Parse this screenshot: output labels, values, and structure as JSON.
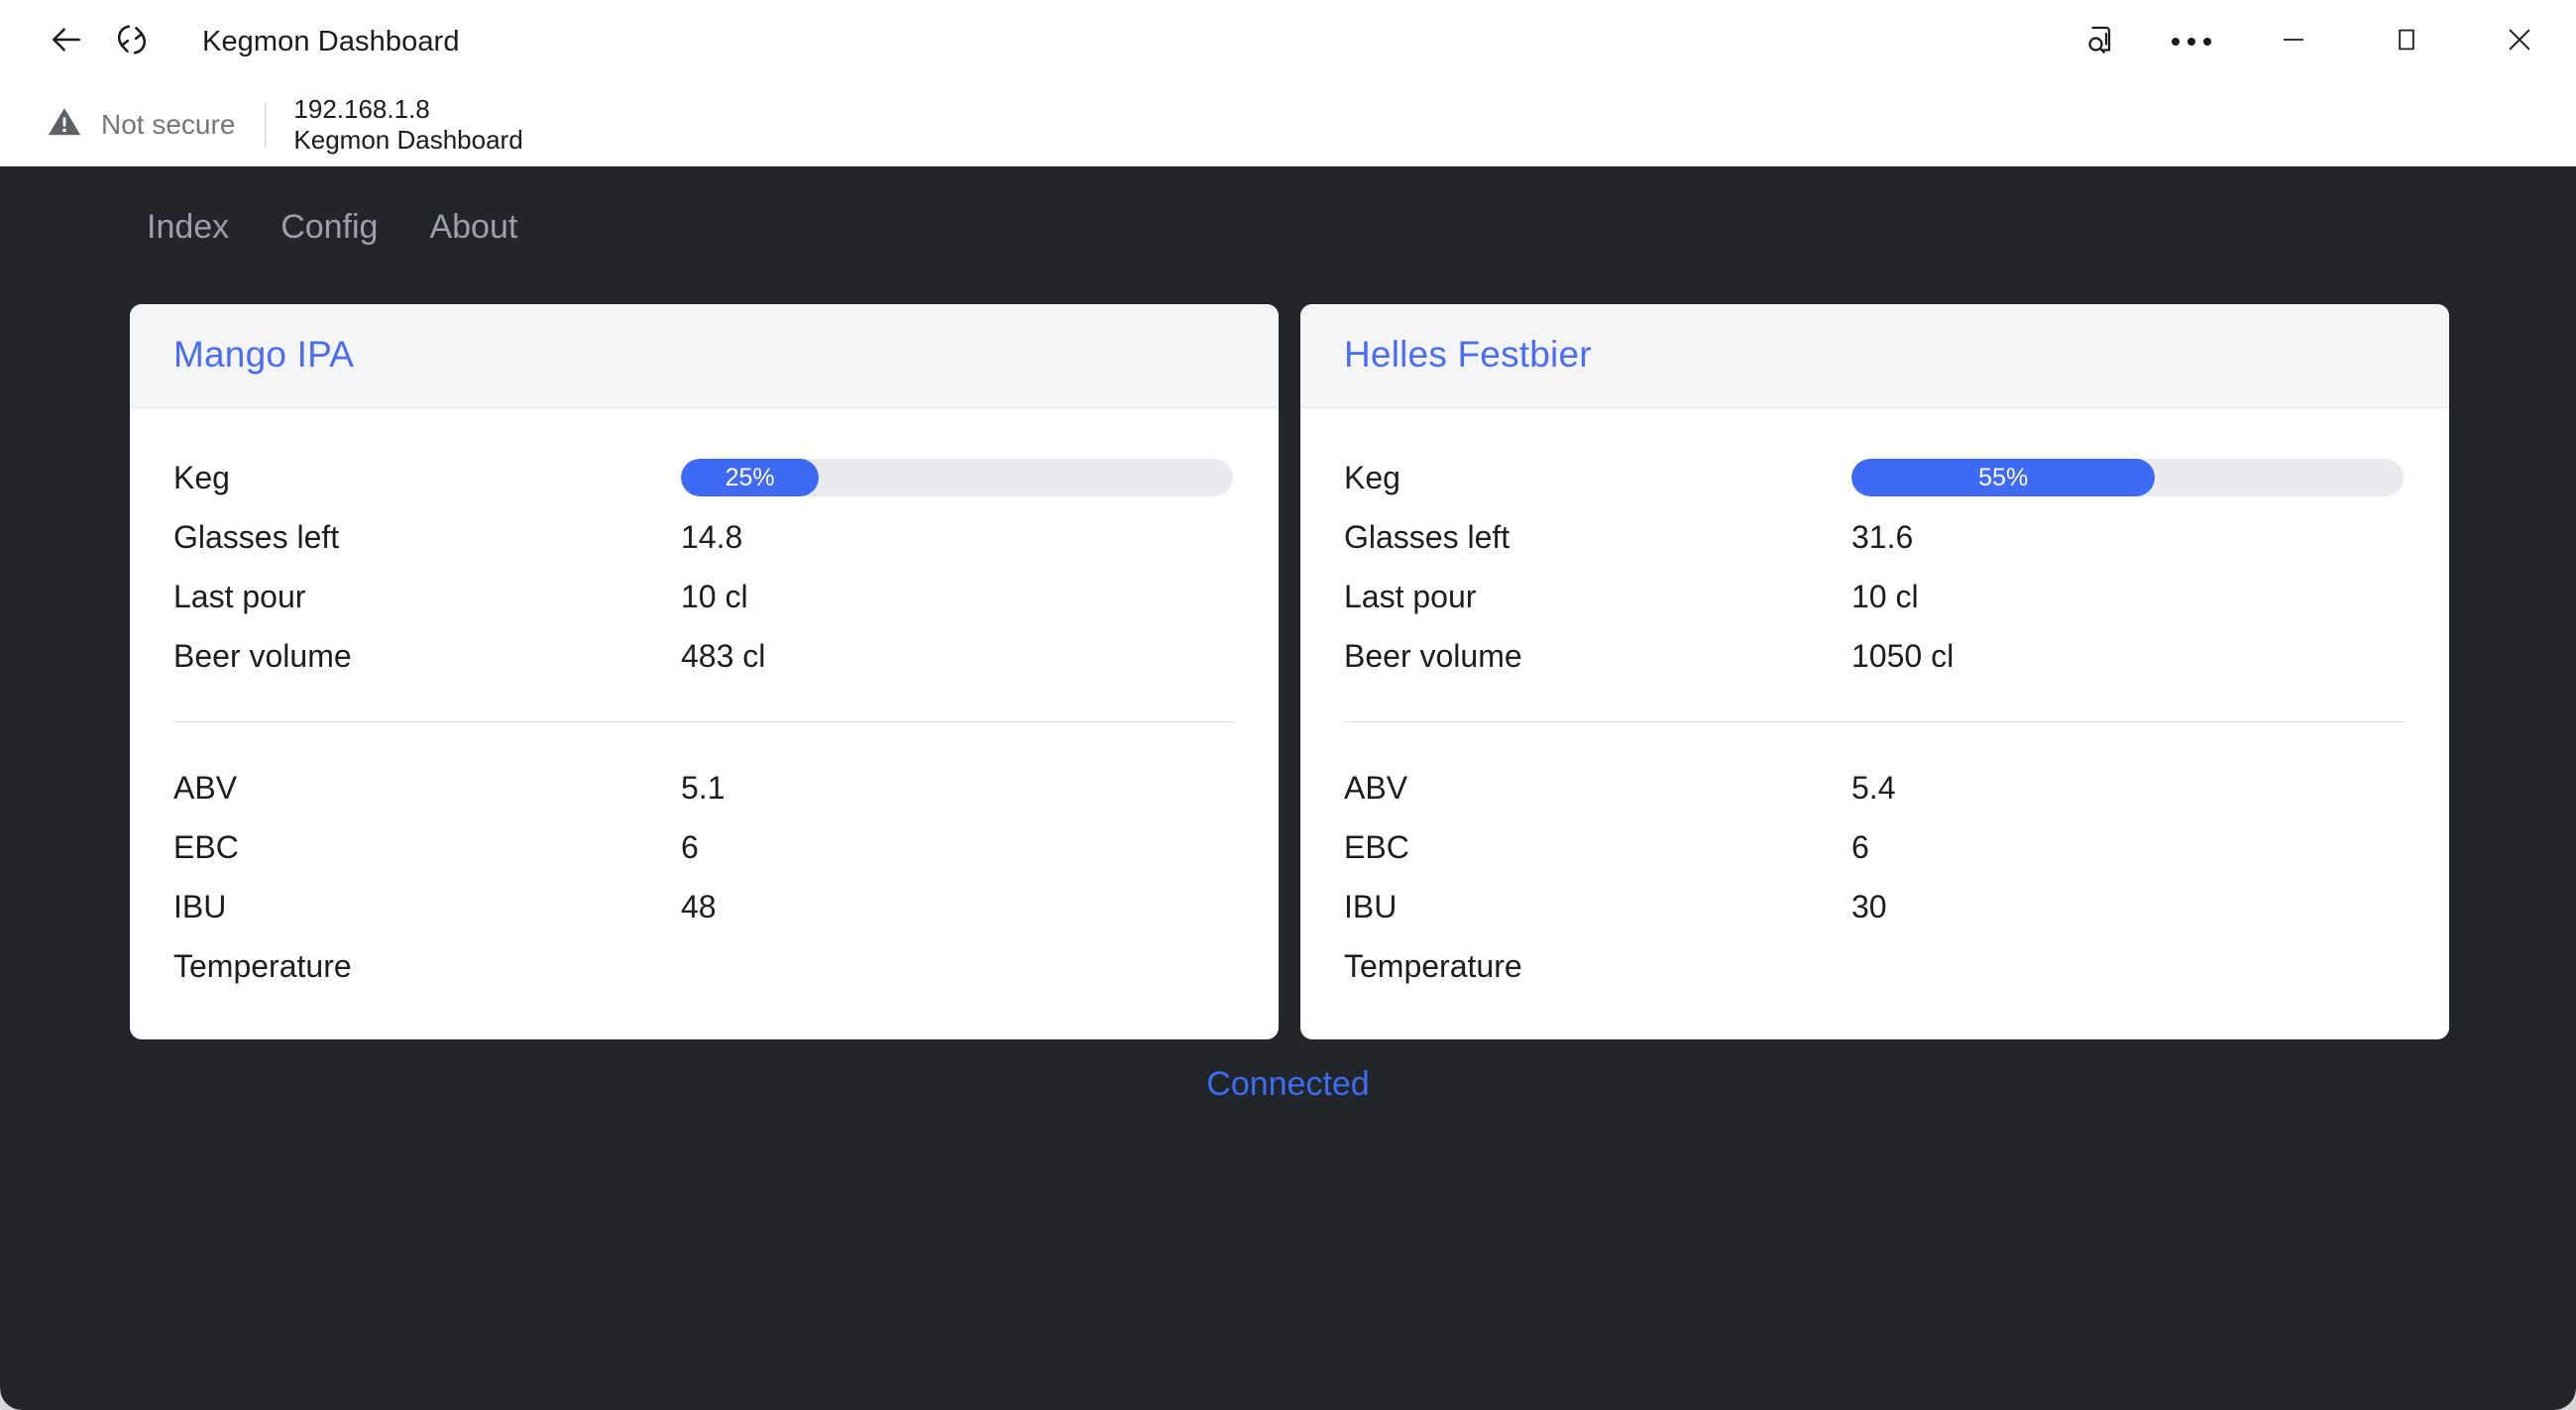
{
  "browser": {
    "title": "Kegmon Dashboard",
    "back_icon": "back-arrow-icon",
    "refresh_icon": "refresh-icon",
    "read_aloud_icon": "read-aloud-icon",
    "more_icon": "more-options-icon",
    "minimize_icon": "minimize-icon",
    "maximize_icon": "maximize-icon",
    "close_icon": "close-icon",
    "security": {
      "icon": "warning-triangle-icon",
      "label": "Not secure"
    },
    "url": {
      "host": "192.168.1.8",
      "subtitle": "Kegmon Dashboard"
    }
  },
  "nav": {
    "items": [
      {
        "label": "Index"
      },
      {
        "label": "Config"
      },
      {
        "label": "About"
      }
    ]
  },
  "colors": {
    "page_background": "#22262b",
    "card_background": "#ffffff",
    "card_header_background": "#f4f5f6",
    "accent_blue": "#4a6cf7",
    "progress_fill": "#3f6af5",
    "progress_track": "#e8eaed",
    "status_text": "#3b6ef5"
  },
  "cards": [
    {
      "title": "Mango IPA",
      "keg": {
        "label": "Keg",
        "percent": 25,
        "percent_text": "25%"
      },
      "rows": [
        {
          "label": "Glasses left",
          "value": "14.8"
        },
        {
          "label": "Last pour",
          "value": "10 cl"
        },
        {
          "label": "Beer volume",
          "value": "483 cl"
        }
      ],
      "stats": [
        {
          "label": "ABV",
          "value": "5.1"
        },
        {
          "label": "EBC",
          "value": "6"
        },
        {
          "label": "IBU",
          "value": "48"
        },
        {
          "label": "Temperature",
          "value": ""
        }
      ]
    },
    {
      "title": "Helles Festbier",
      "keg": {
        "label": "Keg",
        "percent": 55,
        "percent_text": "55%"
      },
      "rows": [
        {
          "label": "Glasses left",
          "value": "31.6"
        },
        {
          "label": "Last pour",
          "value": "10 cl"
        },
        {
          "label": "Beer volume",
          "value": "1050 cl"
        }
      ],
      "stats": [
        {
          "label": "ABV",
          "value": "5.4"
        },
        {
          "label": "EBC",
          "value": "6"
        },
        {
          "label": "IBU",
          "value": "30"
        },
        {
          "label": "Temperature",
          "value": ""
        }
      ]
    }
  ],
  "status": {
    "label": "Connected"
  }
}
